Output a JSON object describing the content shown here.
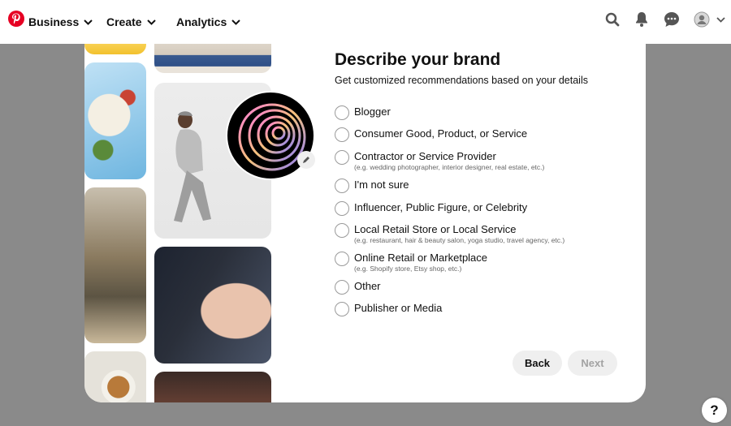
{
  "nav": {
    "logo_icon": "pinterest-logo-icon",
    "items": [
      {
        "label": "Business"
      },
      {
        "label": "Create"
      },
      {
        "label": "Analytics"
      }
    ],
    "right_icons": [
      "search-icon",
      "bell-icon",
      "chat-icon",
      "profile-icon",
      "chevron-down-icon"
    ]
  },
  "modal": {
    "title": "Describe your brand",
    "subtitle": "Get customized recommendations based on your details",
    "options": [
      {
        "label": "Blogger",
        "hint": ""
      },
      {
        "label": "Consumer Good, Product, or Service",
        "hint": ""
      },
      {
        "label": "Contractor or Service Provider",
        "hint": "(e.g. wedding photographer, interior designer, real estate, etc.)"
      },
      {
        "label": "I'm not sure",
        "hint": ""
      },
      {
        "label": "Influencer, Public Figure, or Celebrity",
        "hint": ""
      },
      {
        "label": "Local Retail Store or Local Service",
        "hint": "(e.g. restaurant, hair & beauty salon, yoga studio, travel agency, etc.)"
      },
      {
        "label": "Online Retail or Marketplace",
        "hint": "(e.g. Shopify store, Etsy shop, etc.)"
      },
      {
        "label": "Other",
        "hint": ""
      },
      {
        "label": "Publisher or Media",
        "hint": ""
      }
    ],
    "back_label": "Back",
    "next_label": "Next"
  },
  "help_label": "?",
  "colors": {
    "brand": "#e60023",
    "overlay": "#8a8a8a"
  }
}
